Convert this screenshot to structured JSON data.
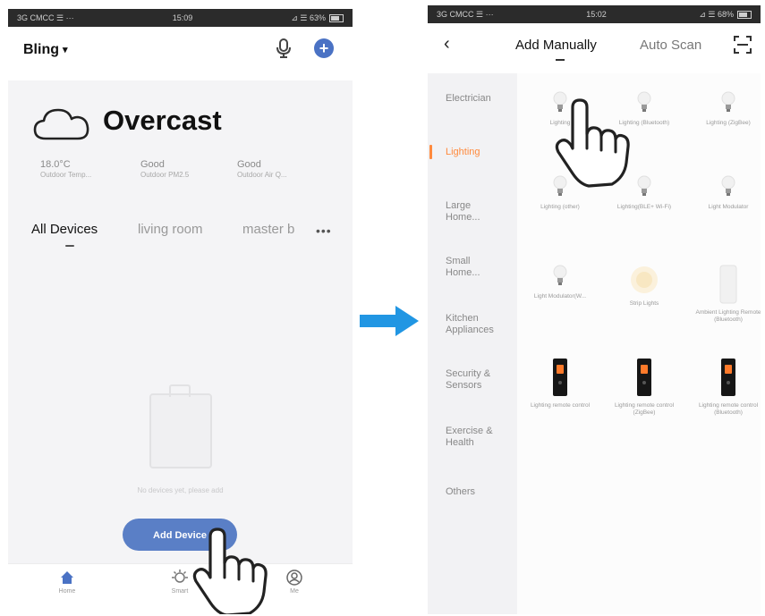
{
  "left_screen": {
    "status": {
      "carrier": "3G CMCC ☰ ···",
      "time": "15:09",
      "right": "⊿ ☰ 63%"
    },
    "header": {
      "home_name": "Bling"
    },
    "weather": {
      "condition": "Overcast"
    },
    "stats": [
      {
        "value": "18.0°C",
        "label": "Outdoor Temp..."
      },
      {
        "value": "Good",
        "label": "Outdoor PM2.5"
      },
      {
        "value": "Good",
        "label": "Outdoor Air Q..."
      }
    ],
    "rooms": [
      "All Devices",
      "living room",
      "master b"
    ],
    "empty_text": "No devices yet, please add",
    "add_device_label": "Add Device",
    "nav": [
      "Home",
      "Smart",
      "Me"
    ]
  },
  "right_screen": {
    "status": {
      "carrier": "3G CMCC ☰ ···",
      "time": "15:02",
      "right": "⊿ ☰ 68%"
    },
    "tabs": {
      "manual": "Add Manually",
      "auto": "Auto Scan"
    },
    "categories": [
      "Electrician",
      "Lighting",
      "Large Home...",
      "Small Home...",
      "Kitchen Appliances",
      "Security & Sensors",
      "Exercise & Health",
      "Others"
    ],
    "active_category": 1,
    "devices": [
      "Lighting",
      "Lighting (Bluetooth)",
      "Lighting (ZigBee)",
      "Lighting (other)",
      "Lighting(BLE+ Wi-Fi)",
      "Light Modulator",
      "Light Modulator(W...",
      "Strip Lights",
      "Ambient Lighting Remote (Bluetooth)",
      "Lighting remote control",
      "Lighting remote control (ZigBee)",
      "Lighting remote control (Bluetooth)"
    ]
  },
  "colors": {
    "accent": "#5a7fc6",
    "active_category": "#ff8a3d",
    "arrow": "#2196e3"
  }
}
